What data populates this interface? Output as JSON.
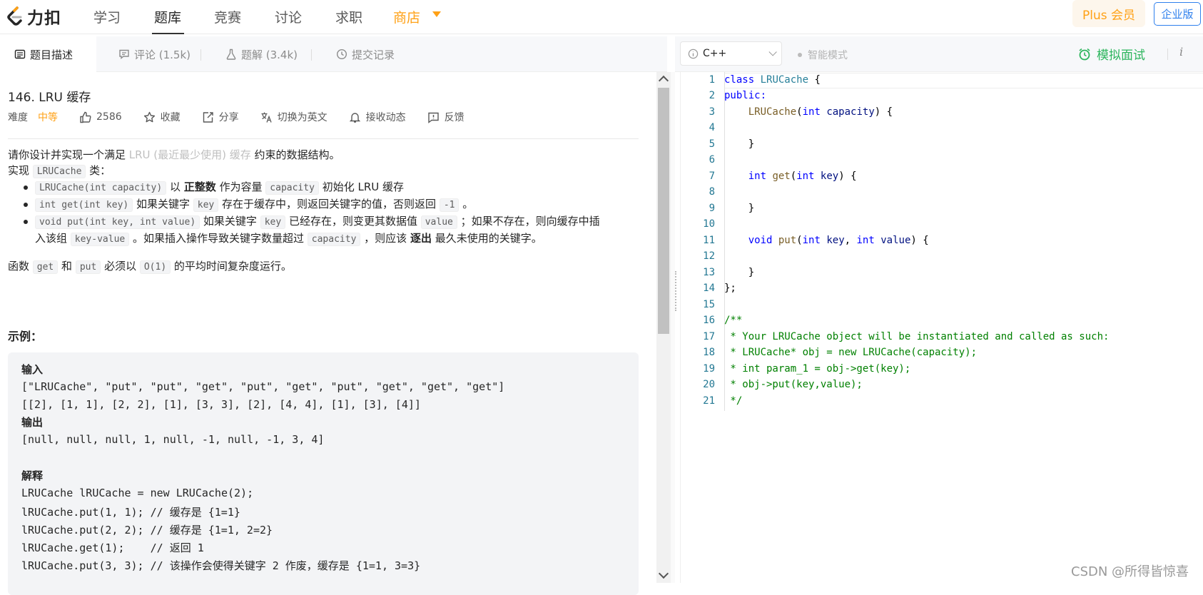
{
  "nav": {
    "logo_text": "力扣",
    "items": [
      "学习",
      "题库",
      "竞赛",
      "讨论",
      "求职"
    ],
    "shop": "商店",
    "plus": "Plus 会员",
    "enterprise": "企业版"
  },
  "tabs": [
    {
      "label": "题目描述"
    },
    {
      "label": "评论 (1.5k)"
    },
    {
      "label": "题解 (3.4k)"
    },
    {
      "label": "提交记录"
    }
  ],
  "toolbar": {
    "language": "C++",
    "smart_mode": "智能模式",
    "mock_interview": "模拟面试",
    "info": "i"
  },
  "problem": {
    "title": "146. LRU 缓存",
    "difficulty_label": "难度",
    "difficulty_value": "中等",
    "likes": "2586",
    "favorite": "收藏",
    "share": "分享",
    "switch_lang": "切换为英文",
    "subscribe": "接收动态",
    "feedback": "反馈",
    "desc_prefix": "请你设计并实现一个满足 ",
    "desc_link": "LRU (最近最少使用) 缓存",
    "desc_suffix": " 约束的数据结构。",
    "impl_prefix": "实现 ",
    "impl_code": "LRUCache",
    "impl_suffix": " 类：",
    "b1_code": "LRUCache(int capacity)",
    "b1_t1": " 以 ",
    "b1_bold": "正整数",
    "b1_t2": " 作为容量 ",
    "b1_code2": "capacity",
    "b1_t3": " 初始化 LRU 缓存",
    "b2_code": "int get(int key)",
    "b2_t1": " 如果关键字 ",
    "b2_code2": "key",
    "b2_t2": " 存在于缓存中，则返回关键字的值，否则返回 ",
    "b2_code3": "-1",
    "b2_t3": " 。",
    "b3_code": "void put(int key, int value)",
    "b3_t1": " 如果关键字 ",
    "b3_code2": "key",
    "b3_t2": " 已经存在，则变更其数据值 ",
    "b3_code3": "value",
    "b3_t3": " ；如果不存在，则向缓存中插",
    "b3_l2_t1": "入该组 ",
    "b3_l2_code": "key-value",
    "b3_l2_t2": " 。如果插入操作导致关键字数量超过 ",
    "b3_l2_code2": "capacity",
    "b3_l2_t3": " ，则应该 ",
    "b3_l2_bold": "逐出",
    "b3_l2_t4": " 最久未使用的关键字。",
    "fn_t1": "函数 ",
    "fn_code1": "get",
    "fn_t2": " 和 ",
    "fn_code2": "put",
    "fn_t3": " 必须以 ",
    "fn_code3": "O(1)",
    "fn_t4": " 的平均时间复杂度运行。",
    "example_title": "示例：",
    "example_lines": [
      "输入",
      "[\"LRUCache\", \"put\", \"put\", \"get\", \"put\", \"get\", \"put\", \"get\", \"get\", \"get\"]",
      "[[2], [1, 1], [2, 2], [1], [3, 3], [2], [4, 4], [1], [3], [4]]",
      "输出",
      "[null, null, null, 1, null, -1, null, -1, 3, 4]",
      "",
      "解释",
      "LRUCache lRUCache = new LRUCache(2);",
      "lRUCache.put(1, 1); // 缓存是 {1=1}",
      "lRUCache.put(2, 2); // 缓存是 {1=1, 2=2}",
      "lRUCache.get(1);    // 返回 1",
      "lRUCache.put(3, 3); // 该操作会使得关键字 2 作废，缓存是 {1=1, 3=3}"
    ]
  },
  "editor": {
    "line_numbers": [
      "1",
      "2",
      "3",
      "4",
      "5",
      "6",
      "7",
      "8",
      "9",
      "10",
      "11",
      "12",
      "13",
      "14",
      "15",
      "16",
      "17",
      "18",
      "19",
      "20",
      "21"
    ],
    "code": {
      "l1_kw": "class",
      "l1_ty": "LRUCache",
      "l1_rest": " {",
      "l2_kw": "public:",
      "l3_fn": "LRUCache",
      "l3_p1": "(",
      "l3_kw": "int",
      "l3_pm": "capacity",
      "l3_p2": ") {",
      "l5": "}",
      "l7_kw": "int",
      "l7_fn": "get",
      "l7_p1": "(",
      "l7_kw2": "int",
      "l7_pm": "key",
      "l7_p2": ") {",
      "l9": "}",
      "l11_kw": "void",
      "l11_fn": "put",
      "l11_p1": "(",
      "l11_kw2": "int",
      "l11_pm": "key",
      "l11_p2": ", ",
      "l11_kw3": "int",
      "l11_pm2": "value",
      "l11_p3": ") {",
      "l13": "}",
      "l14": "};",
      "l16": "/**",
      "l17": " * Your LRUCache object will be instantiated and called as such:",
      "l18": " * LRUCache* obj = new LRUCache(capacity);",
      "l19": " * int param_1 = obj->get(key);",
      "l20": " * obj->put(key,value);",
      "l21": " */"
    }
  },
  "watermark": "CSDN @所得皆惊喜",
  "colors": {
    "accent_orange": "#ffa116",
    "green": "#2db55d",
    "blue": "#2f80ed"
  }
}
